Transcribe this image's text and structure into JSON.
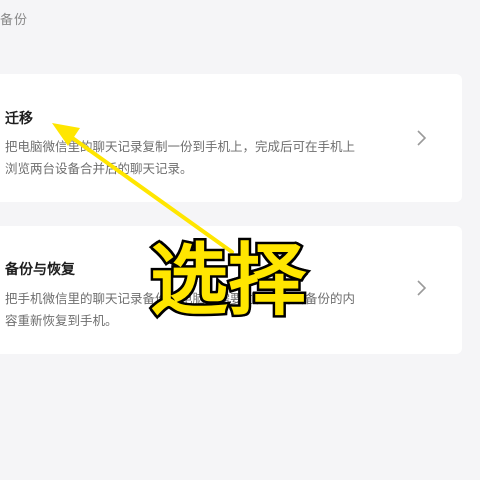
{
  "header": {
    "title": "备份"
  },
  "cards": [
    {
      "title": "迁移",
      "description": "把电脑微信里的聊天记录复制一份到手机上，完成后可在手机上浏览两台设备合并后的聊天记录。"
    },
    {
      "title": "备份与恢复",
      "description": "把手机微信里的聊天记录备份到电脑，需要时，可将所备份的内容重新恢复到手机。"
    }
  ],
  "annotation": {
    "label": "选择",
    "color": "#ffe600"
  },
  "icons": {
    "chevron": "chevron-right-icon",
    "arrow": "yellow-arrow"
  }
}
